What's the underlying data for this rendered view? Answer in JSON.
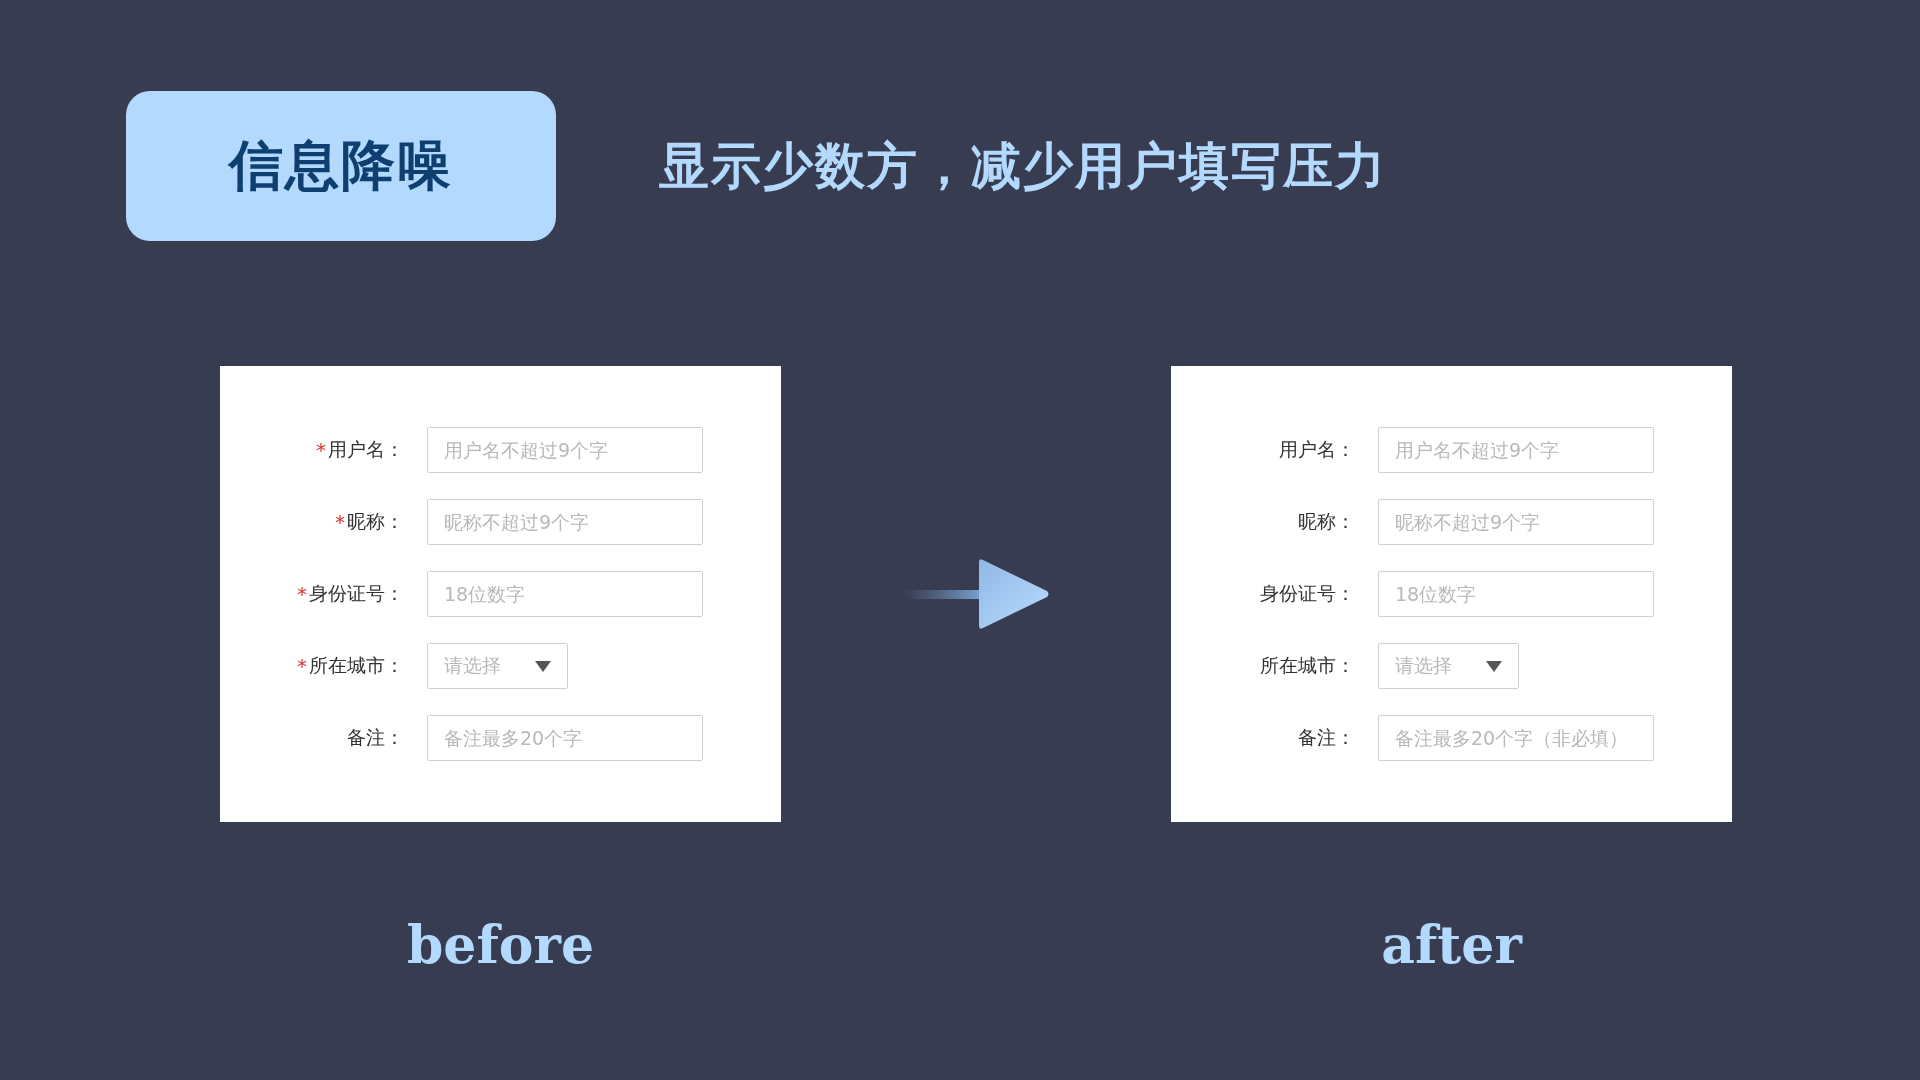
{
  "badge": "信息降噪",
  "required_mark": "*",
  "subtitle": "显示少数方，减少用户填写压力",
  "forms": [
    {
      "caption": "before",
      "fields": [
        {
          "label": "用户名：",
          "required": true,
          "kind": "text",
          "placeholder": "用户名不超过9个字"
        },
        {
          "label": "昵称：",
          "required": true,
          "kind": "text",
          "placeholder": "昵称不超过9个字"
        },
        {
          "label": "身份证号：",
          "required": true,
          "kind": "text",
          "placeholder": "18位数字"
        },
        {
          "label": "所在城市：",
          "required": true,
          "kind": "select",
          "placeholder": "请选择"
        },
        {
          "label": "备注：",
          "required": false,
          "kind": "text",
          "placeholder": "备注最多20个字"
        }
      ]
    },
    {
      "caption": "after",
      "fields": [
        {
          "label": "用户名：",
          "required": false,
          "kind": "text",
          "placeholder": "用户名不超过9个字"
        },
        {
          "label": "昵称：",
          "required": false,
          "kind": "text",
          "placeholder": "昵称不超过9个字"
        },
        {
          "label": "身份证号：",
          "required": false,
          "kind": "text",
          "placeholder": "18位数字"
        },
        {
          "label": "所在城市：",
          "required": false,
          "kind": "select",
          "placeholder": "请选择"
        },
        {
          "label": "备注：",
          "required": false,
          "kind": "text",
          "placeholder": "备注最多20个字（非必填）"
        }
      ]
    }
  ]
}
